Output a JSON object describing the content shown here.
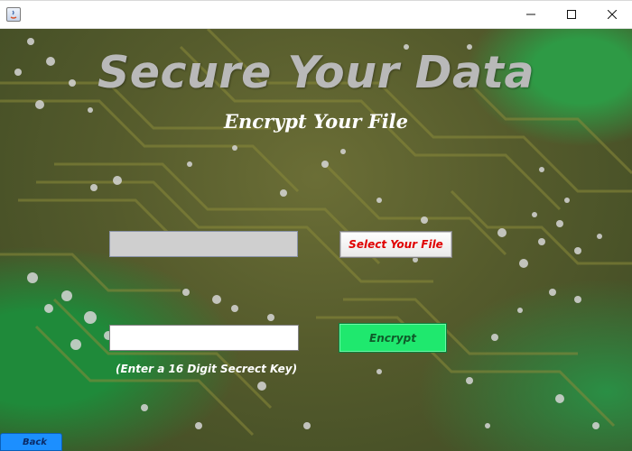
{
  "window": {
    "app_icon": "java-app-icon",
    "controls": [
      "minimize-icon",
      "maximize-icon",
      "close-icon"
    ]
  },
  "header": {
    "title": "Secure Your Data",
    "subtitle": "Encrypt Your File"
  },
  "file_section": {
    "path_value": "",
    "select_button": "Select Your File"
  },
  "key_section": {
    "key_value": "",
    "encrypt_button": "Encrypt",
    "hint": "(Enter a 16 Digit Secrect Key)"
  },
  "footer": {
    "back_button": "Back"
  },
  "colors": {
    "select_text": "#e00000",
    "encrypt_bg": "#1fe86e",
    "back_bg": "#1c8fff"
  }
}
